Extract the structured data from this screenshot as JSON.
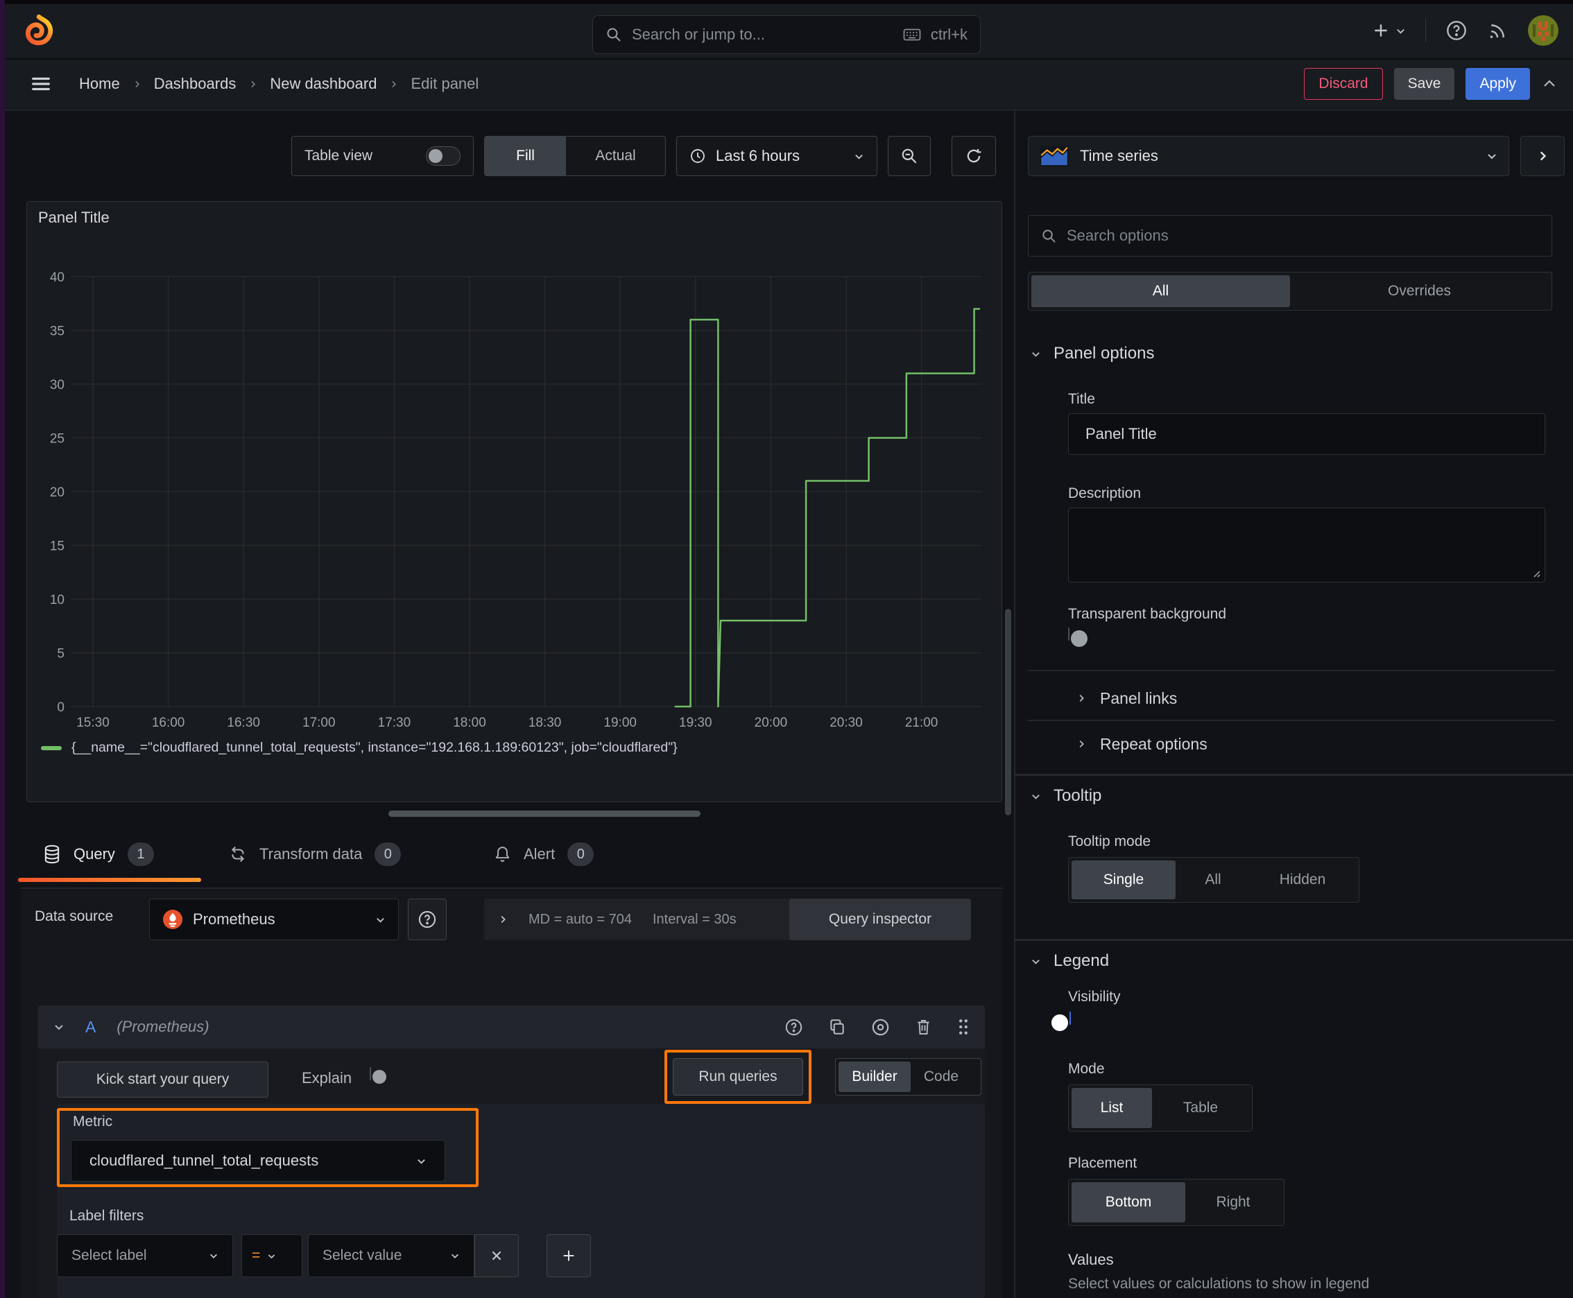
{
  "topbar": {
    "search_placeholder": "Search or jump to...",
    "search_shortcut": "ctrl+k"
  },
  "breadcrumb": {
    "items": [
      {
        "label": "Home"
      },
      {
        "label": "Dashboards"
      },
      {
        "label": "New dashboard"
      },
      {
        "label": "Edit panel"
      }
    ]
  },
  "header_actions": {
    "discard": "Discard",
    "save": "Save",
    "apply": "Apply"
  },
  "view_toolbar": {
    "table_view": "Table view",
    "fill": "Fill",
    "actual": "Actual",
    "time_range": "Last 6 hours"
  },
  "panel": {
    "title": "Panel Title"
  },
  "chart_data": {
    "type": "line",
    "title": "Panel Title",
    "x_ticks": [
      "15:30",
      "16:00",
      "16:30",
      "17:00",
      "17:30",
      "18:00",
      "18:30",
      "19:00",
      "19:30",
      "20:00",
      "20:30",
      "21:00"
    ],
    "y_ticks": [
      0,
      5,
      10,
      15,
      20,
      25,
      30,
      35,
      40
    ],
    "ylim": [
      0,
      40
    ],
    "x_axis": {
      "tick_interval_minutes": 30,
      "range_label": "Last 6 hours"
    },
    "grid": true,
    "legend_position": "bottom",
    "series": [
      {
        "name": "{__name__=\"cloudflared_tunnel_total_requests\", instance=\"192.168.1.189:60123\", job=\"cloudflared\"}",
        "color": "#73bf69",
        "type": "step",
        "x_unit": "minutes_after_15:30",
        "points": [
          [
            232,
            0
          ],
          [
            238,
            0
          ],
          [
            238,
            36
          ],
          [
            249,
            36
          ],
          [
            249,
            0
          ],
          [
            250,
            8
          ],
          [
            284,
            8
          ],
          [
            284,
            21
          ],
          [
            309,
            21
          ],
          [
            309,
            25
          ],
          [
            324,
            25
          ],
          [
            324,
            31
          ],
          [
            351,
            31
          ],
          [
            351,
            37
          ],
          [
            353,
            37
          ]
        ]
      }
    ]
  },
  "query_section": {
    "tabs": [
      {
        "label": "Query",
        "count": "1"
      },
      {
        "label": "Transform data",
        "count": "0"
      },
      {
        "label": "Alert",
        "count": "0"
      }
    ],
    "datasource_label": "Data source",
    "datasource": "Prometheus",
    "collapsed_stats": {
      "max_data_points": "MD = auto = 704",
      "interval": "Interval = 30s"
    },
    "query_inspector": "Query inspector",
    "ref_id": "A",
    "ref_hint": "(Prometheus)",
    "kick_start": "Kick start your query",
    "explain": "Explain",
    "run_queries": "Run queries",
    "builder": "Builder",
    "code": "Code",
    "metric_label": "Metric",
    "metric_value": "cloudflared_tunnel_total_requests",
    "label_filters_label": "Label filters",
    "select_label": "Select label",
    "operator": "=",
    "select_value": "Select value"
  },
  "viz_picker": {
    "name": "Time series"
  },
  "options_pane": {
    "search_placeholder": "Search options",
    "tab_all": "All",
    "tab_overrides": "Overrides",
    "panel_options": {
      "heading": "Panel options",
      "title_label": "Title",
      "title_value": "Panel Title",
      "description_label": "Description",
      "transparent_label": "Transparent background",
      "links": "Panel links",
      "repeat": "Repeat options"
    },
    "tooltip": {
      "heading": "Tooltip",
      "mode_label": "Tooltip mode",
      "modes": [
        {
          "label": "Single"
        },
        {
          "label": "All"
        },
        {
          "label": "Hidden"
        }
      ]
    },
    "legend": {
      "heading": "Legend",
      "visibility_label": "Visibility",
      "mode_label": "Mode",
      "modes": [
        {
          "label": "List"
        },
        {
          "label": "Table"
        }
      ],
      "placement_label": "Placement",
      "placements": [
        {
          "label": "Bottom"
        },
        {
          "label": "Right"
        }
      ],
      "values_label": "Values",
      "values_hint": "Select values or calculations to show in legend"
    }
  },
  "colors": {
    "accent_orange": "#ff780a",
    "apply_blue": "#3d71d9",
    "discard_red": "#e03a5e",
    "series_green": "#73bf69",
    "tab_underline_from": "#f2552c",
    "tab_underline_to": "#ff9830"
  }
}
